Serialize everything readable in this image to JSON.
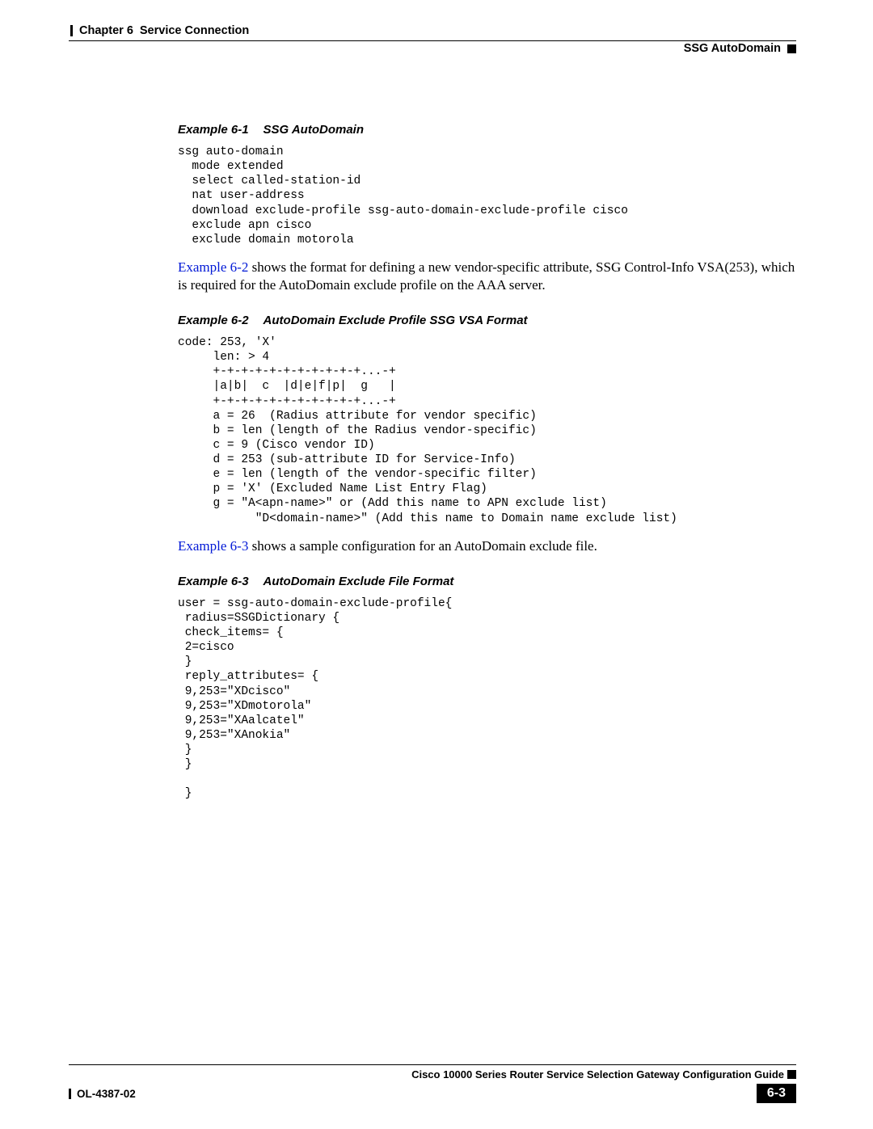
{
  "header": {
    "chapter_label": "Chapter 6",
    "chapter_title": "Service Connection",
    "section_title": "SSG AutoDomain"
  },
  "example1": {
    "label": "Example 6-1",
    "title": "SSG AutoDomain",
    "code": "ssg auto-domain\n  mode extended\n  select called-station-id\n  nat user-address\n  download exclude-profile ssg-auto-domain-exclude-profile cisco\n  exclude apn cisco\n  exclude domain motorola"
  },
  "para1": {
    "link": "Example 6-2",
    "rest": " shows the format for defining a new vendor-specific attribute, SSG Control-Info VSA(253), which is required for the AutoDomain exclude profile on the AAA server."
  },
  "example2": {
    "label": "Example 6-2",
    "title": "AutoDomain Exclude Profile SSG VSA Format",
    "code": "code: 253, 'X'\n     len: > 4\n     +-+-+-+-+-+-+-+-+-+-+...-+\n     |a|b|  c  |d|e|f|p|  g   |\n     +-+-+-+-+-+-+-+-+-+-+...-+\n     a = 26  (Radius attribute for vendor specific)\n     b = len (length of the Radius vendor-specific)\n     c = 9 (Cisco vendor ID)\n     d = 253 (sub-attribute ID for Service-Info)\n     e = len (length of the vendor-specific filter)\n     p = 'X' (Excluded Name List Entry Flag)\n     g = \"A<apn-name>\" or (Add this name to APN exclude list)\n           \"D<domain-name>\" (Add this name to Domain name exclude list)"
  },
  "para2": {
    "link": "Example 6-3",
    "rest": " shows a sample configuration for an AutoDomain exclude file."
  },
  "example3": {
    "label": "Example 6-3",
    "title": "AutoDomain Exclude File Format",
    "code": "user = ssg-auto-domain-exclude-profile{\n radius=SSGDictionary {\n check_items= {\n 2=cisco\n }\n reply_attributes= {\n 9,253=\"XDcisco\"\n 9,253=\"XDmotorola\"\n 9,253=\"XAalcatel\"\n 9,253=\"XAnokia\"\n }\n }\n\n }"
  },
  "footer": {
    "guide_title": "Cisco 10000 Series Router Service Selection Gateway Configuration Guide",
    "doc_id": "OL-4387-02",
    "page_num": "6-3"
  }
}
